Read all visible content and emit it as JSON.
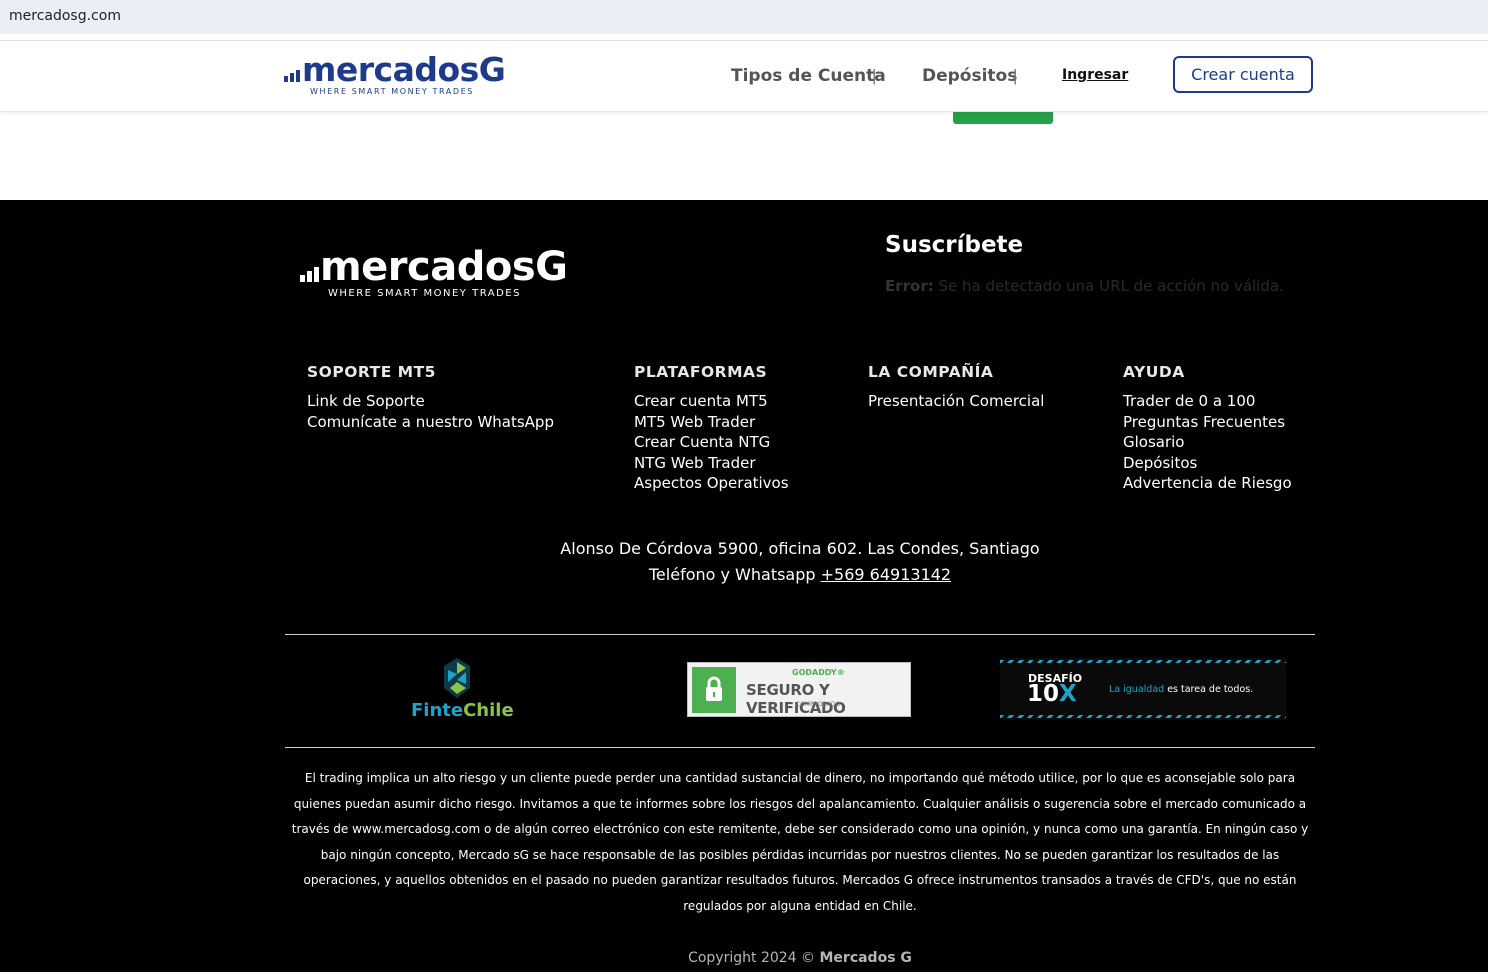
{
  "browser": {
    "url": "mercadosg.com"
  },
  "header": {
    "logo": {
      "word": "mercadosG",
      "tagline": "WHERE SMART MONEY TRADES"
    },
    "nav": [
      {
        "label": "Tipos de Cuenta"
      },
      {
        "label": "Depósitos"
      }
    ],
    "separator": "|",
    "login_label": "Ingresar",
    "create_account_label": "Crear cuenta"
  },
  "footer": {
    "logo": {
      "word": "mercadosG",
      "tagline": "WHERE SMART MONEY TRADES"
    },
    "subscribe": {
      "title": "Suscríbete",
      "error_label": "Error:",
      "error_text": "Se ha detectado una URL de acción no válida."
    },
    "columns": [
      {
        "title": "SOPORTE MT5",
        "links": [
          "Link de Soporte",
          "Comunícate a nuestro WhatsApp"
        ]
      },
      {
        "title": "PLATAFORMAS",
        "links": [
          "Crear cuenta MT5",
          "MT5 Web Trader",
          "Crear Cuenta NTG",
          "NTG Web Trader",
          "Aspectos Operativos"
        ]
      },
      {
        "title": "LA COMPAÑÍA",
        "links": [
          "Presentación Comercial"
        ]
      },
      {
        "title": "AYUDA",
        "links": [
          "Trader de 0 a 100",
          "Preguntas Frecuentes",
          "Glosario",
          "Depósitos",
          "Advertencia de Riesgo"
        ]
      }
    ],
    "address_line": "Alonso De Córdova 5900, oficina 602. Las Condes, Santiago",
    "phone_label": "Teléfono y Whatsapp",
    "phone_number": "+569 64913142",
    "badges": {
      "fintech": {
        "name_a": "Finte",
        "name_b": "Chile"
      },
      "godaddy": {
        "top": "GODADDY®",
        "main": "SEGURO Y VERIFICADO",
        "bottom": "COMPROBADO"
      },
      "desafio": {
        "line1": "DESAFÍO",
        "line2_num": "10",
        "line2_x": "X",
        "slogan_accent": "La igualdad",
        "slogan_rest": " es tarea de todos."
      }
    },
    "disclaimer": "El trading implica un alto riesgo y un cliente puede perder una cantidad sustancial de dinero, no importando qué método utilice, por lo que es aconsejable solo para quienes puedan asumir dicho riesgo. Invitamos a que te informes sobre los riesgos del apalancamiento. Cualquier análisis o sugerencia sobre el mercado comunicado a través de www.mercadosg.com o de algún correo electrónico con este remitente, debe ser considerado como una opinión, y nunca como una garantía. En ningún caso y bajo ningún concepto, Mercado sG se hace responsable de las posibles pérdidas incurridas por nuestros clientes. No se pueden garantizar los resultados de las operaciones, y aquellos obtenidos en el pasado no pueden garantizar resultados futuros. Mercados G ofrece instrumentos transados a través de CFD's, que no están regulados por alguna entidad en Chile.",
    "copyright_text": "Copyright 2024 ©",
    "copyright_brand": "Mercados G"
  },
  "colors": {
    "brand_blue": "#1e3a8a",
    "green_button": "#26a04a",
    "footer_bg": "#000000",
    "accent_cyan": "#1ea3c9"
  }
}
